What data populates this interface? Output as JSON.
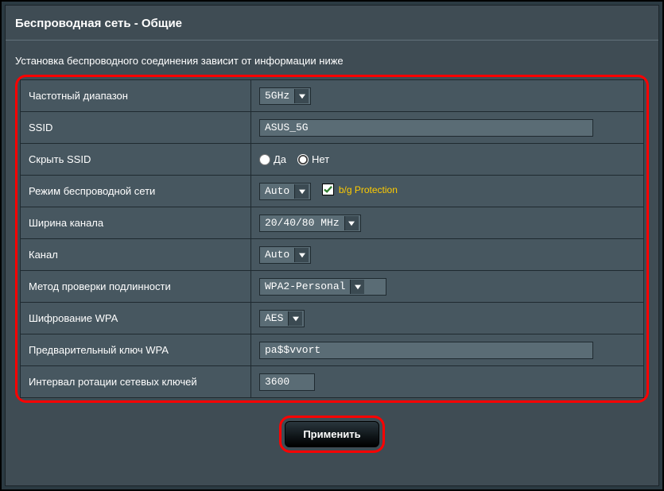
{
  "page": {
    "title": "Беспроводная сеть - Общие",
    "subtitle": "Установка беспроводного соединения зависит от информации ниже"
  },
  "labels": {
    "band": "Частотный диапазон",
    "ssid": "SSID",
    "hide_ssid": "Скрыть SSID",
    "mode": "Режим беспроводной сети",
    "width": "Ширина канала",
    "channel": "Канал",
    "auth": "Метод проверки подлинности",
    "wpa_enc": "Шифрование WPA",
    "wpa_key": "Предварительный ключ WPA",
    "rekey": "Интервал ротации сетевых ключей"
  },
  "values": {
    "band": "5GHz",
    "ssid": "ASUS_5G",
    "hide_ssid_yes": "Да",
    "hide_ssid_no": "Нет",
    "hide_ssid_selected": "no",
    "mode": "Auto",
    "bg_protection_checked": true,
    "bg_protection_label": "b/g Protection",
    "width": "20/40/80 MHz",
    "channel": "Auto",
    "auth": "WPA2-Personal",
    "wpa_enc": "AES",
    "wpa_key": "pa$$vvort",
    "rekey": "3600"
  },
  "buttons": {
    "apply": "Применить"
  }
}
